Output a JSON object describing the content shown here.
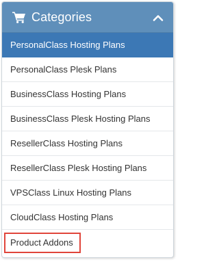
{
  "header": {
    "title": "Categories",
    "cart_icon": "cart-icon",
    "collapse_icon": "chevron-up-icon",
    "background_color": "#5f8fba"
  },
  "categories": [
    {
      "label": "PersonalClass Hosting Plans",
      "active": true
    },
    {
      "label": "PersonalClass Plesk Plans",
      "active": false
    },
    {
      "label": "BusinessClass Hosting Plans",
      "active": false
    },
    {
      "label": "BusinessClass Plesk Hosting Plans",
      "active": false
    },
    {
      "label": "ResellerClass Hosting Plans",
      "active": false
    },
    {
      "label": "ResellerClass Plesk Hosting Plans",
      "active": false
    },
    {
      "label": "VPSClass Linux Hosting Plans",
      "active": false
    },
    {
      "label": "CloudClass Hosting Plans",
      "active": false
    },
    {
      "label": "Product Addons",
      "active": false,
      "highlighted": true
    }
  ],
  "colors": {
    "active_item": "#3c78b5",
    "highlight_border": "#e0443a",
    "text": "#333333"
  }
}
